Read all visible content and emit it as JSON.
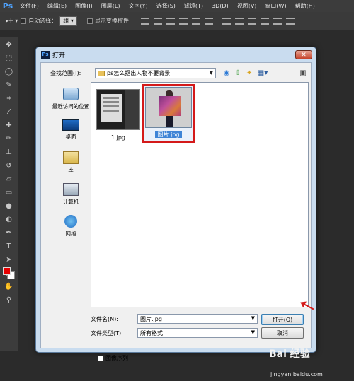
{
  "app": {
    "logo": "Ps",
    "menu": [
      "文件(F)",
      "编辑(E)",
      "图像(I)",
      "图层(L)",
      "文字(Y)",
      "选择(S)",
      "滤镜(T)",
      "3D(D)",
      "视图(V)",
      "窗口(W)",
      "帮助(H)"
    ]
  },
  "options_bar": {
    "auto_select_label": "自动选择：",
    "auto_select_value": "组",
    "show_transform_label": "显示变换控件"
  },
  "toolbar": {
    "tools": [
      "move-tool",
      "marquee-tool",
      "lasso-tool",
      "quick-select-tool",
      "crop-tool",
      "eyedropper-tool",
      "healing-tool",
      "brush-tool",
      "stamp-tool",
      "history-brush-tool",
      "eraser-tool",
      "gradient-tool",
      "blur-tool",
      "dodge-tool",
      "pen-tool",
      "type-tool",
      "path-select-tool",
      "shape-tool",
      "hand-tool",
      "zoom-tool"
    ],
    "foreground_color": "#e60000",
    "background_color": "#ffffff"
  },
  "dialog": {
    "title": "打开",
    "look_in_label": "查找范围(I):",
    "look_in_value": "ps怎么抠出人物不要背景",
    "places": [
      {
        "label": "最近访问的位置",
        "icon": "recent-places-icon"
      },
      {
        "label": "桌面",
        "icon": "desktop-icon"
      },
      {
        "label": "库",
        "icon": "libraries-icon"
      },
      {
        "label": "计算机",
        "icon": "computer-icon"
      },
      {
        "label": "网络",
        "icon": "network-icon"
      }
    ],
    "files": [
      {
        "name": "1.jpg",
        "selected": false
      },
      {
        "name": "图片.jpg",
        "selected": true
      }
    ],
    "file_name_label": "文件名(N):",
    "file_name_value": "图片.jpg",
    "file_type_label": "文件类型(T):",
    "file_type_value": "所有格式",
    "open_button": "打开(O)",
    "cancel_button": "取消",
    "image_sequence_label": "图像序列"
  },
  "watermark": {
    "text": "Bai 经验",
    "url": "jingyan.baidu.com"
  }
}
